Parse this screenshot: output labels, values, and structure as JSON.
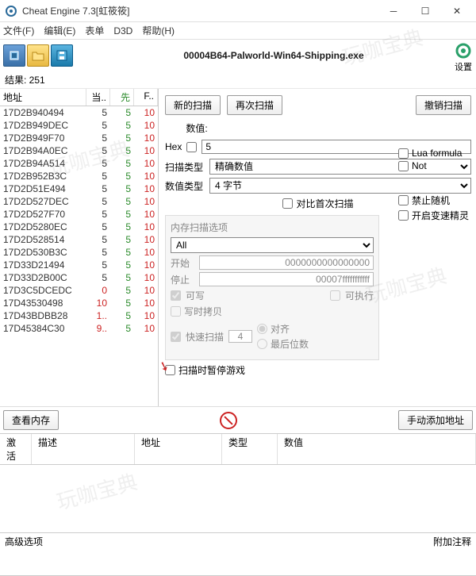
{
  "window": {
    "title": "Cheat Engine 7.3[虹筱筱]"
  },
  "menu": {
    "file": "文件(F)",
    "edit": "编辑(E)",
    "table": "表单",
    "d3d": "D3D",
    "help": "帮助(H)"
  },
  "toolbar": {
    "process": "00004B64-Palworld-Win64-Shipping.exe",
    "settings": "设置"
  },
  "found": {
    "label": "结果: 251"
  },
  "grid": {
    "headers": {
      "addr": "地址",
      "cur": "当..",
      "prev": "先",
      "first": "F.."
    },
    "rows": [
      {
        "addr": "17D2B940494",
        "cur": "5",
        "prev": "5",
        "first": "10"
      },
      {
        "addr": "17D2B949DEC",
        "cur": "5",
        "prev": "5",
        "first": "10"
      },
      {
        "addr": "17D2B949F70",
        "cur": "5",
        "prev": "5",
        "first": "10"
      },
      {
        "addr": "17D2B94A0EC",
        "cur": "5",
        "prev": "5",
        "first": "10"
      },
      {
        "addr": "17D2B94A514",
        "cur": "5",
        "prev": "5",
        "first": "10"
      },
      {
        "addr": "17D2B952B3C",
        "cur": "5",
        "prev": "5",
        "first": "10"
      },
      {
        "addr": "17D2D51E494",
        "cur": "5",
        "prev": "5",
        "first": "10"
      },
      {
        "addr": "17D2D527DEC",
        "cur": "5",
        "prev": "5",
        "first": "10"
      },
      {
        "addr": "17D2D527F70",
        "cur": "5",
        "prev": "5",
        "first": "10"
      },
      {
        "addr": "17D2D5280EC",
        "cur": "5",
        "prev": "5",
        "first": "10"
      },
      {
        "addr": "17D2D528514",
        "cur": "5",
        "prev": "5",
        "first": "10"
      },
      {
        "addr": "17D2D530B3C",
        "cur": "5",
        "prev": "5",
        "first": "10"
      },
      {
        "addr": "17D33D21494",
        "cur": "5",
        "prev": "5",
        "first": "10"
      },
      {
        "addr": "17D33D2B00C",
        "cur": "5",
        "prev": "5",
        "first": "10"
      },
      {
        "addr": "17D3C5DCEDC",
        "cur": "0",
        "prev": "5",
        "first": "10"
      },
      {
        "addr": "17D43530498",
        "cur": "10",
        "prev": "5",
        "first": "10"
      },
      {
        "addr": "17D43BDBB28",
        "cur": "1..",
        "prev": "5",
        "first": "10"
      },
      {
        "addr": "17D45384C30",
        "cur": "9..",
        "prev": "5",
        "first": "10"
      }
    ]
  },
  "scan": {
    "new": "新的扫描",
    "next": "再次扫描",
    "undo": "撤销扫描",
    "value_lbl": "数值:",
    "hex": "Hex",
    "value": "5",
    "scantype_lbl": "扫描类型",
    "scantype": "精确数值",
    "valtype_lbl": "数值类型",
    "valtype": "4 字节",
    "compare_first": "对比首次扫描",
    "lua": "Lua formula",
    "not": "Not",
    "no_rand": "禁止随机",
    "speedhack": "开启变速精灵",
    "memopt": "内存扫描选项",
    "all": "All",
    "start_lbl": "开始",
    "start": "0000000000000000",
    "stop_lbl": "停止",
    "stop": "00007fffffffffff",
    "writable": "可写",
    "executable": "可执行",
    "cow": "写时拷贝",
    "fastscan": "快速扫描",
    "fastval": "4",
    "align": "对齐",
    "lastdigits": "最后位数",
    "pause": "扫描时暂停游戏"
  },
  "buttons": {
    "viewmem": "查看内存",
    "addaddr": "手动添加地址"
  },
  "listhdr": {
    "active": "激活",
    "desc": "描述",
    "addr": "地址",
    "type": "类型",
    "val": "数值"
  },
  "status": {
    "adv": "高级选项",
    "table": "附加注释"
  }
}
